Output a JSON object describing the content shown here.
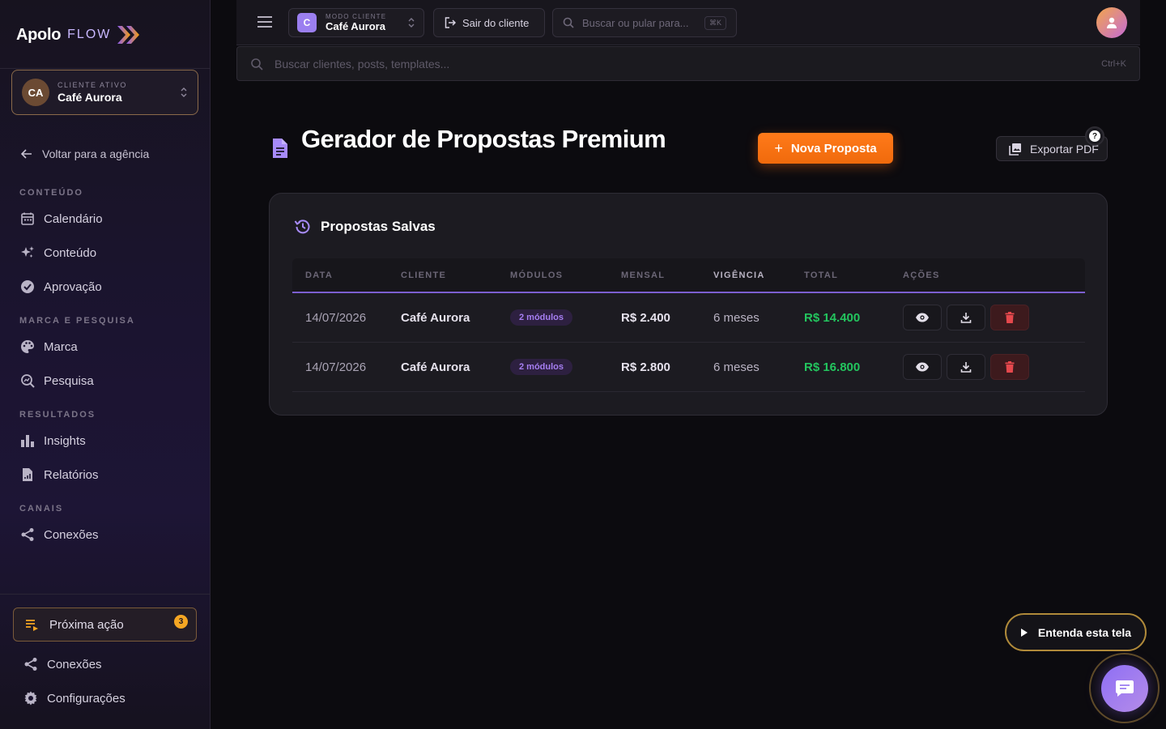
{
  "brand": {
    "name": "Apolo",
    "product": "FLOW"
  },
  "client_card": {
    "initials": "CA",
    "label": "CLIENTE ATIVO",
    "name": "Café Aurora"
  },
  "sidebar": {
    "back": "Voltar para a agência",
    "sections": [
      {
        "title": "CONTEÚDO",
        "items": [
          "Calendário",
          "Conteúdo",
          "Aprovação"
        ]
      },
      {
        "title": "MARCA E PESQUISA",
        "items": [
          "Marca",
          "Pesquisa"
        ]
      },
      {
        "title": "RESULTADOS",
        "items": [
          "Insights",
          "Relatórios"
        ]
      },
      {
        "title": "CANAIS",
        "items": [
          "Conexões"
        ]
      }
    ],
    "next_action": {
      "label": "Próxima ação",
      "count": "3"
    },
    "footer": [
      "Conexões",
      "Configurações"
    ]
  },
  "topbar": {
    "mode_initial": "C",
    "mode_label": "MODO CLIENTE",
    "mode_client": "Café Aurora",
    "exit": "Sair do cliente",
    "search_placeholder": "Buscar ou pular para...",
    "search_kbd": "⌘K"
  },
  "global_search": {
    "placeholder": "Buscar clientes, posts, templates...",
    "shortcut": "Ctrl+K"
  },
  "page": {
    "title": "Gerador de Propostas Premium",
    "new_button": "Nova Proposta",
    "export_button": "Exportar PDF",
    "help": "?"
  },
  "saved": {
    "title": "Propostas Salvas",
    "columns": [
      "DATA",
      "CLIENTE",
      "MÓDULOS",
      "MENSAL",
      "VIGÊNCIA",
      "TOTAL",
      "AÇÕES"
    ],
    "rows": [
      {
        "date": "14/07/2026",
        "client": "Café Aurora",
        "modules": "2 módulos",
        "monthly": "R$ 2.400",
        "term": "6 meses",
        "total": "R$ 14.400"
      },
      {
        "date": "14/07/2026",
        "client": "Café Aurora",
        "modules": "2 módulos",
        "monthly": "R$ 2.800",
        "term": "6 meses",
        "total": "R$ 16.800"
      }
    ]
  },
  "floating": {
    "understand": "Entenda esta tela"
  },
  "colors": {
    "accent_orange": "#f06a0c",
    "accent_purple": "#7c5fd0",
    "positive": "#23c55e",
    "danger": "#e5484d"
  }
}
